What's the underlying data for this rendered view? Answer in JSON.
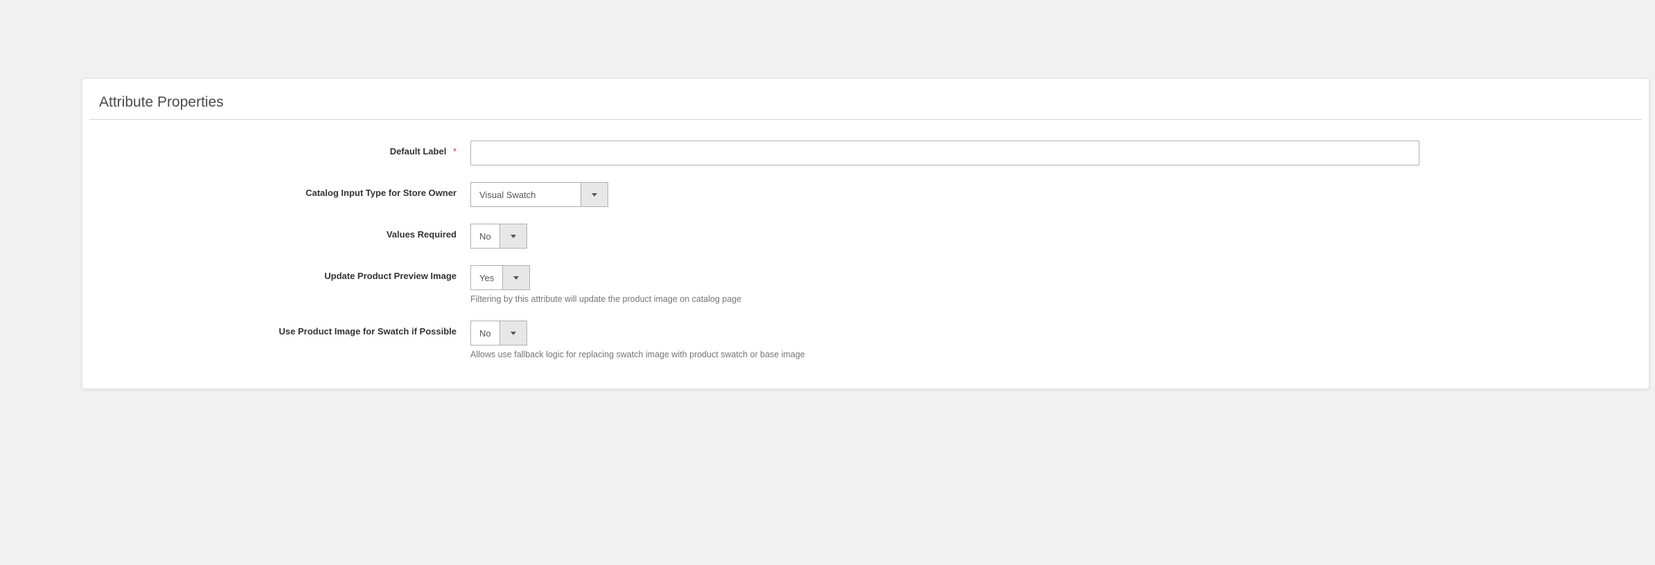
{
  "section_title": "Attribute Properties",
  "fields": {
    "default_label": {
      "label": "Default Label",
      "required": true,
      "value": ""
    },
    "catalog_input_type": {
      "label": "Catalog Input Type for Store Owner",
      "value": "Visual Swatch"
    },
    "values_required": {
      "label": "Values Required",
      "value": "No"
    },
    "update_preview": {
      "label": "Update Product Preview Image",
      "value": "Yes",
      "help": "Filtering by this attribute will update the product image on catalog page"
    },
    "use_product_image": {
      "label": "Use Product Image for Swatch if Possible",
      "value": "No",
      "help": "Allows use fallback logic for replacing swatch image with product swatch or base image"
    }
  }
}
